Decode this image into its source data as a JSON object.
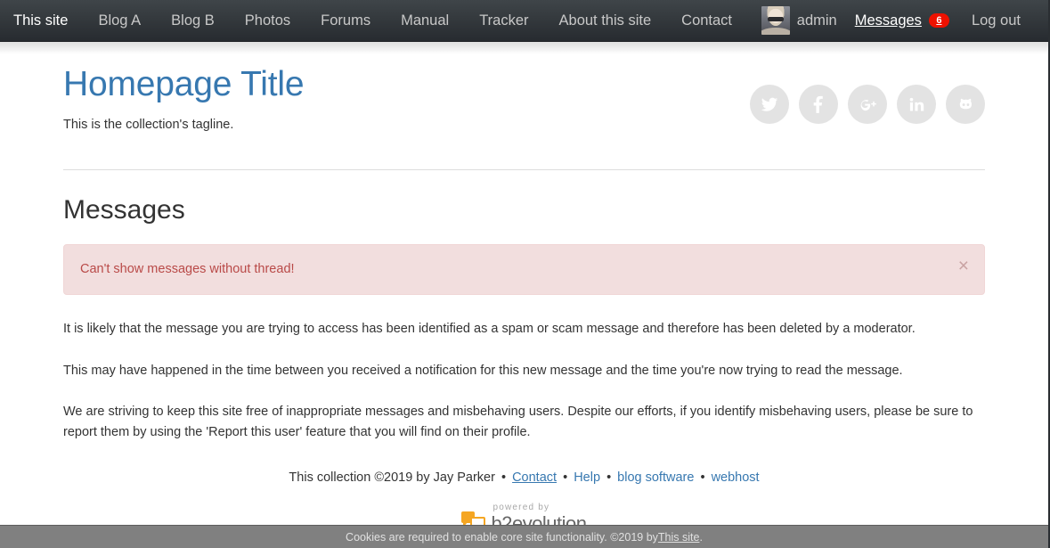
{
  "navbar": {
    "items": [
      {
        "label": "This site",
        "active": true
      },
      {
        "label": "Blog A",
        "active": false
      },
      {
        "label": "Blog B",
        "active": false
      },
      {
        "label": "Photos",
        "active": false
      },
      {
        "label": "Forums",
        "active": false
      },
      {
        "label": "Manual",
        "active": false
      },
      {
        "label": "Tracker",
        "active": false
      },
      {
        "label": "About this site",
        "active": false
      },
      {
        "label": "Contact",
        "active": false
      }
    ],
    "username": "admin",
    "avatar_icon": "user-avatar-photo",
    "messages_label": "Messages",
    "messages_count": "6",
    "logout_label": "Log out",
    "badge_color": "#ee1100",
    "background_color": "#272b30"
  },
  "header": {
    "title": "Homepage Title",
    "title_color": "#3778b0",
    "tagline": "This is the collection's tagline.",
    "social": [
      {
        "name": "twitter-icon",
        "title": "Twitter"
      },
      {
        "name": "facebook-icon",
        "title": "Facebook"
      },
      {
        "name": "google-plus-icon",
        "title": "Google+"
      },
      {
        "name": "linkedin-icon",
        "title": "LinkedIn"
      },
      {
        "name": "github-icon",
        "title": "GitHub"
      }
    ]
  },
  "main": {
    "heading": "Messages",
    "alert": {
      "text": "Can't show messages without thread!",
      "close_label": "×",
      "background_color": "#f2dede",
      "text_color": "#b94a48"
    },
    "paragraphs": [
      "It is likely that the message you are trying to access has been identified as a spam or scam message and therefore has been deleted by a moderator.",
      "This may have happened in the time between you received a notification for this new message and the time you're now trying to read the message.",
      "We are striving to keep this site free of inappropriate messages and misbehaving users. Despite our efforts, if you identify misbehaving users, please be sure to report them by using the 'Report this user' feature that you will find on their profile."
    ]
  },
  "credits": {
    "prefix": "This collection ©2019 by Jay Parker",
    "links": [
      {
        "label": "Contact",
        "underlined": true
      },
      {
        "label": "Help",
        "underlined": false
      },
      {
        "label": "blog software",
        "underlined": false
      },
      {
        "label": "webhost",
        "underlined": false
      }
    ],
    "separator": "•"
  },
  "powered_by": {
    "small_text": "powered by",
    "brand_prefix": "b2",
    "brand_suffix": "evolution",
    "accent_color": "#f5a623"
  },
  "cookie_bar": {
    "text_before": "Cookies are required to enable core site functionality. ©2019 by ",
    "link_label": "This site",
    "text_after": "."
  }
}
